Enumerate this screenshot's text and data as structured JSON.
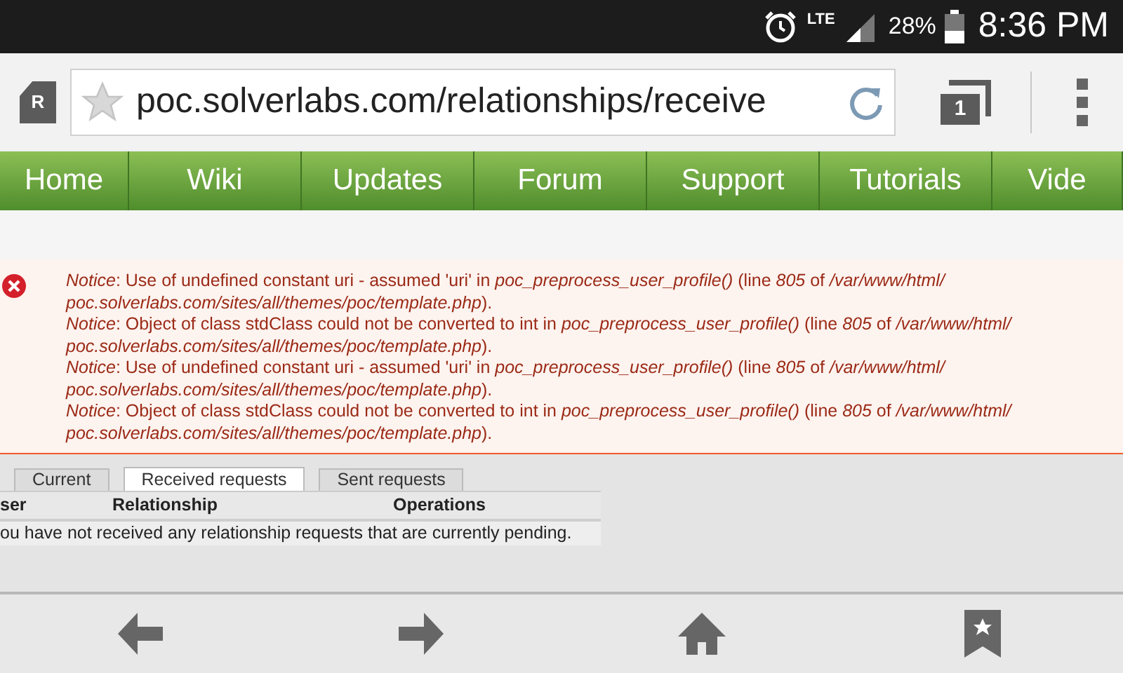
{
  "status_bar": {
    "network": "LTE",
    "battery": "28%",
    "time": "8:36 PM"
  },
  "browser": {
    "url": "poc.solverlabs.com/relationships/receive",
    "tab_count": "1",
    "reader_badge": "R"
  },
  "nav": [
    {
      "label": "Home"
    },
    {
      "label": "Wiki"
    },
    {
      "label": "Updates"
    },
    {
      "label": "Forum"
    },
    {
      "label": "Support"
    },
    {
      "label": "Tutorials"
    },
    {
      "label": "Vide"
    }
  ],
  "notices": [
    {
      "lines": [
        "*Notice*: Use of undefined constant uri - assumed 'uri' in *poc_preprocess_user_profile()* (line *805* of */var/www/html/*",
        "*poc.solverlabs.com/sites/all/themes/poc/template.php*)."
      ]
    },
    {
      "lines": [
        "*Notice*: Object of class stdClass could not be converted to int in *poc_preprocess_user_profile()* (line *805* of */var/www/html/*",
        "*poc.solverlabs.com/sites/all/themes/poc/template.php*)."
      ]
    },
    {
      "lines": [
        "*Notice*: Use of undefined constant uri - assumed 'uri' in *poc_preprocess_user_profile()* (line *805* of */var/www/html/*",
        "*poc.solverlabs.com/sites/all/themes/poc/template.php*)."
      ]
    },
    {
      "lines": [
        "*Notice*: Object of class stdClass could not be converted to int in *poc_preprocess_user_profile()* (line *805* of */var/www/html/*",
        "*poc.solverlabs.com/sites/all/themes/poc/template.php*)."
      ]
    }
  ],
  "tabs": [
    {
      "label": "Current",
      "selected": false
    },
    {
      "label": "Received requests",
      "selected": true
    },
    {
      "label": "Sent requests",
      "selected": false
    }
  ],
  "table": {
    "columns": [
      "ser",
      "Relationship",
      "Operations"
    ],
    "empty_message": "ou have not received any relationship requests that are currently pending."
  }
}
